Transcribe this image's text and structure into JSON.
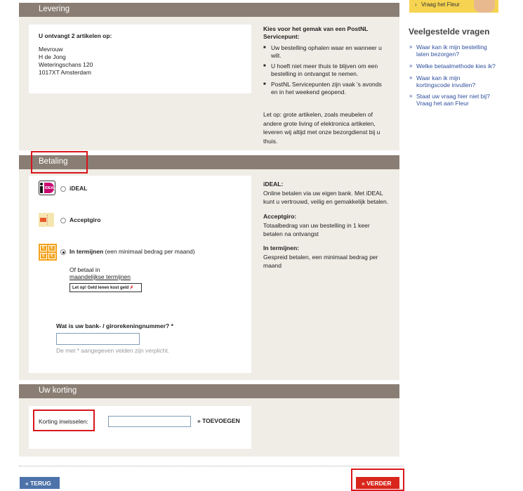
{
  "sidebar": {
    "banner_label": "Vraag het Fleur",
    "title": "Veelgestelde vragen",
    "faq": [
      "Waar kan ik mijn bestelling laten bezorgen?",
      "Welke betaalmethode kies ik?",
      "Waar kan ik mijn kortingscode invullen?",
      "Staat uw vraag hier niet bij? Vraag het aan Fleur"
    ]
  },
  "delivery": {
    "header": "Levering",
    "count_line": "U ontvangt 2 artikelen op:",
    "address": [
      "Mevrouw",
      "H de Jong",
      "Weteringschans 120",
      "1017XT Amsterdam"
    ],
    "postnl_title": "Kies voor het gemak van een PostNL Servicepunt:",
    "bullets": [
      "Uw bestelling ophalen waar en wanneer u wilt.",
      "U hoeft niet meer thuis te blijven om een bestelling in ontvangst te nemen.",
      "PostNL Servicepunten zijn vaak 's avonds en in het weekend geopend."
    ],
    "note": "Let op: grote artikelen, zoals meubelen of andere grote living of elektronica artikelen, leveren wij altijd met onze bezorgdienst bij u thuis."
  },
  "payment": {
    "header": "Betaling",
    "options": [
      {
        "label": "iDEAL",
        "extra": "",
        "icon": "ideal-logo"
      },
      {
        "label": "Acceptgiro",
        "extra": "",
        "icon": "acceptgiro-icon"
      },
      {
        "label": "In termijnen",
        "extra": " (een minimaal bedrag per maand)",
        "icon": "termijnen-icon"
      }
    ],
    "selected": "In termijnen",
    "or_pay": "Of betaal in",
    "monthly_link": "maandelijkse termijnen",
    "warning_badge": "Let op! Geld lenen kost geld",
    "bank_label": "Wat is uw bank- / girorekeningnummer?",
    "required_mark": "*",
    "bank_value": "",
    "required_note": "De met * aangegeven velden zijn verplicht.",
    "info": [
      {
        "title": "iDEAL:",
        "text": "Online betalen via uw eigen bank. Met iDEAL kunt u vertrouwd, veilig en gemakkelijk betalen."
      },
      {
        "title": "Acceptgiro:",
        "text": "Totaalbedrag van uw bestelling in 1 keer betalen na ontvangst"
      },
      {
        "title": "In termijnen:",
        "text": "Gespreid betalen, een minimaal bedrag per maand"
      }
    ]
  },
  "discount": {
    "header": "Uw korting",
    "label": "Korting inwisselen:",
    "value": "",
    "add_button": "TOEVOEGEN"
  },
  "nav": {
    "back": "TERUG",
    "next": "VERDER"
  },
  "colors": {
    "header_bg": "#8a7e74",
    "panel_bg": "#efede6",
    "highlight": "#d9161c",
    "link": "#2e4f9c",
    "back_button": "#4d73a9",
    "next_button": "#d9261c"
  }
}
